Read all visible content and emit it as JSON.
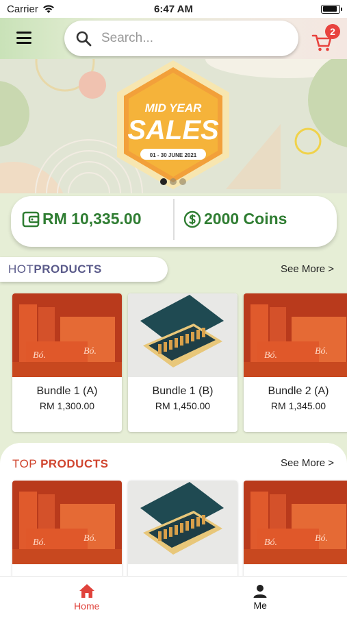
{
  "status_bar": {
    "carrier": "Carrier",
    "time": "6:47 AM",
    "battery_level": 0.9
  },
  "header": {
    "search_placeholder": "Search...",
    "cart_count": "2",
    "accent": "#e8433e"
  },
  "banner": {
    "line1": "MID YEAR",
    "line2": "SALES",
    "dates": "01 - 30 JUNE 2021",
    "slide_count": 3,
    "active_slide": 0
  },
  "wallet": {
    "balance": "RM 10,335.00",
    "coins": "2000 Coins",
    "color": "#2f7d32"
  },
  "hot_products": {
    "title_a": "HOT ",
    "title_b": "PRODUCTS",
    "title_color": "#5a5a8a",
    "see_more": "See More >",
    "items": [
      {
        "name": "Bundle 1 (A)",
        "price": "RM 1,300.00",
        "image": "orange-boxes"
      },
      {
        "name": "Bundle 1 (B)",
        "price": "RM 1,450.00",
        "image": "vial-box"
      },
      {
        "name": "Bundle 2 (A)",
        "price": "RM 1,345.00",
        "image": "orange-boxes"
      }
    ]
  },
  "top_products": {
    "title_a": "TOP ",
    "title_b": "PRODUCTS",
    "title_color": "#d0452f",
    "see_more": "See More >",
    "items": [
      {
        "image": "orange-boxes"
      },
      {
        "image": "vial-box"
      },
      {
        "image": "orange-boxes"
      }
    ]
  },
  "bottom_nav": {
    "home": "Home",
    "me": "Me",
    "active_color": "#e0433c"
  }
}
